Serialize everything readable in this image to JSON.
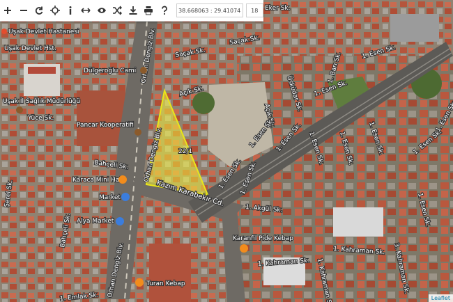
{
  "toolbar": {
    "buttons": [
      {
        "name": "zoom-in-button",
        "icon": "plus-icon",
        "glyph": "+"
      },
      {
        "name": "zoom-out-button",
        "icon": "minus-icon",
        "glyph": "−"
      },
      {
        "name": "refresh-button",
        "icon": "refresh-icon",
        "glyph": "⟳"
      },
      {
        "name": "locate-button",
        "icon": "crosshair-icon",
        "glyph": "⌖"
      },
      {
        "name": "info-button",
        "icon": "info-icon",
        "glyph": "i"
      },
      {
        "name": "measure-button",
        "icon": "arrows-horizontal-icon",
        "glyph": "↔"
      },
      {
        "name": "view-button",
        "icon": "eye-icon",
        "glyph": "◉"
      },
      {
        "name": "shuffle-button",
        "icon": "shuffle-icon",
        "glyph": "⇄"
      },
      {
        "name": "download-button",
        "icon": "download-icon",
        "glyph": "⤓"
      },
      {
        "name": "print-button",
        "icon": "printer-icon",
        "glyph": "⎙"
      },
      {
        "name": "help-button",
        "icon": "question-icon",
        "glyph": "?"
      }
    ],
    "coordinates": "38.668063 : 29.41074",
    "zoom_level": "18"
  },
  "map": {
    "parcel_label": "22/1",
    "streets": {
      "orhan_dengiz_1": "Orhan Dengiz Blv.",
      "orhan_dengiz_2": "Orhan Dengiz Blv.",
      "orhan_dengiz_3": "Orhan Dengiz Blv.",
      "kazim_karabekir": "Kazım Karabekir Cd.",
      "sacak_1": "Saçak Sk.",
      "sacak_2": "Saçak Sk.",
      "acik_1": "Açık Sk.",
      "acik_2": "Açık Sk.",
      "esen_1": "1. Esen Sk.",
      "esen_2": "1. Esen Sk.",
      "esen_3": "1. Esen Sk.",
      "esen_4": "1. Esen Sk.",
      "esen_5": "1. Esen Sk.",
      "esen_6": "1. Esen Sk.",
      "esen_7": "1. Esen Sk.",
      "esen_8": "1. Esen Sk.",
      "esen_9": "1. Esen Sk.",
      "esen_10": "1. Esen Sk.",
      "esen_11": "1. Esen Sk.",
      "esen_12": "1. Esen Sk.",
      "esen_13": "1. Esen Sk.",
      "esen_14": "1. Esen Sk.",
      "esen_15": "1. Esen Sk.",
      "esen_16": "1. Esen Sk.",
      "yuce": "Yüce Sk.",
      "bahceli_1": "Bahçeli Sk.",
      "bahceli_2": "Bahçeli Sk.",
      "serel": "Şerel Sk.",
      "akgul": "1. Akgül Sk.",
      "kahraman_1": "1. Kahraman Sk.",
      "kahraman_2": "1. Kahraman Sk.",
      "kahraman_3": "3. Kahraman Sk.",
      "kahraman_4": "1. Kahraman Sk.",
      "ekser": "Eker Sk.",
      "emlak": "1. Emlak Sk.",
      "bari": "1. Barı Sk.",
      "alt_esen": "1. Esen Sk.",
      "uskuda": "Üsküdar Sk."
    },
    "pois": {
      "hastane": "Uşak Devlet Hastanesi",
      "devlet_hst": "Uşak Devlet Hst.",
      "saglik": "Uşak İl Sağlık Müdürlüğü",
      "cami": "Dülgeroğlu Cami",
      "pancar": "Pancar Kooperatifi",
      "karaca": "Karaca Mini Hal",
      "market": "Market",
      "alya": "Alya Market",
      "karanfil": "Karanfil Pide Kebap",
      "turan": "Turan Kebap"
    }
  },
  "attribution": "Leaflet"
}
